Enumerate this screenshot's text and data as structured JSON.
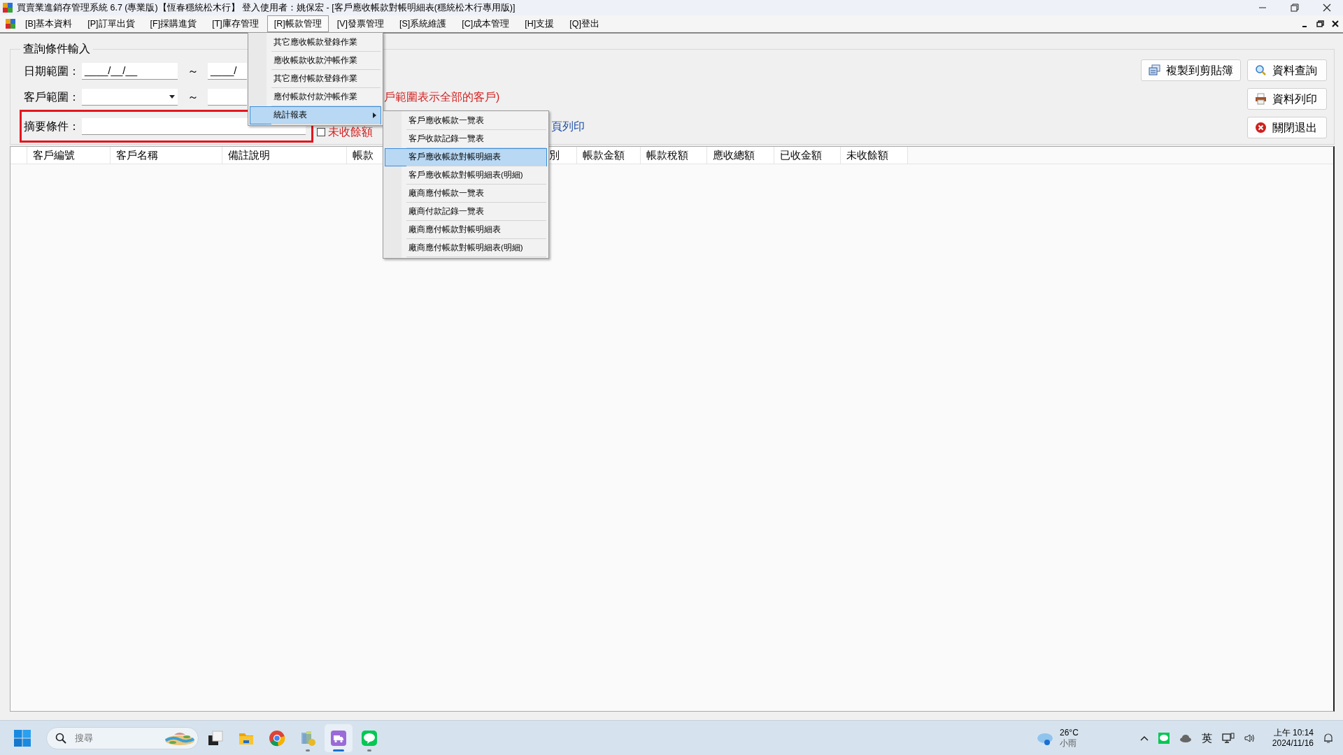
{
  "window": {
    "title": "買賣業進銷存管理系統 6.7 (專業版)【恆春穩統松木行】 登入使用者：姚保宏 - [客戶應收帳款對帳明細表(穩統松木行專用版)]"
  },
  "menu_bar": {
    "items": [
      {
        "label": "[B]基本資料",
        "selected": false
      },
      {
        "label": "[P]訂單出貨",
        "selected": false
      },
      {
        "label": "[F]採購進貨",
        "selected": false
      },
      {
        "label": "[T]庫存管理",
        "selected": false
      },
      {
        "label": "[R]帳款管理",
        "selected": true
      },
      {
        "label": "[V]發票管理",
        "selected": false
      },
      {
        "label": "[S]系統維護",
        "selected": false
      },
      {
        "label": "[C]成本管理",
        "selected": false
      },
      {
        "label": "[H]支援",
        "selected": false
      },
      {
        "label": "[Q]登出",
        "selected": false
      }
    ]
  },
  "dropdown": {
    "items": [
      {
        "label": "其它應收帳款登錄作業",
        "selected": false,
        "has_submenu": false
      },
      {
        "label": "應收帳款收款沖帳作業",
        "selected": false,
        "has_submenu": false
      },
      {
        "label": "其它應付帳款登錄作業",
        "selected": false,
        "has_submenu": false
      },
      {
        "label": "應付帳款付款沖帳作業",
        "selected": false,
        "has_submenu": false
      },
      {
        "label": "統計報表",
        "selected": true,
        "has_submenu": true
      }
    ]
  },
  "submenu": {
    "items": [
      {
        "label": "客戶應收帳款一覽表",
        "selected": false
      },
      {
        "label": "客戶收款記錄一覽表",
        "selected": false
      },
      {
        "label": "客戶應收帳款對帳明細表",
        "selected": true
      },
      {
        "label": "客戶應收帳款對帳明細表(明細)",
        "selected": false
      },
      {
        "label": "廠商應付帳款一覽表",
        "selected": false
      },
      {
        "label": "廠商付款記錄一覽表",
        "selected": false
      },
      {
        "label": "廠商應付帳款對帳明細表",
        "selected": false
      },
      {
        "label": "廠商應付帳款對帳明細表(明細)",
        "selected": false
      }
    ]
  },
  "filter_group": {
    "title": "查詢條件輸入",
    "date_range": {
      "label": "日期範圍：",
      "from": "____/__/__",
      "separator": "～",
      "to": "____/"
    },
    "customer_range": {
      "label": "客戶範圍：",
      "separator": "～",
      "hint": "戶範圍表示全部的客戶)"
    },
    "summary": {
      "label": "摘要條件：",
      "highlighted": true
    },
    "unpaid_only": {
      "label": "未收餘額",
      "checked": false
    },
    "page_break": {
      "label": "頁列印"
    }
  },
  "buttons": [
    {
      "label": "複製到剪貼簿",
      "kind": "copy"
    },
    {
      "label": "資料查詢",
      "kind": "search"
    },
    {
      "label": "資料列印",
      "kind": "print"
    },
    {
      "label": "關閉退出",
      "kind": "close"
    }
  ],
  "table": {
    "columns": [
      "客戶編號",
      "客戶名稱",
      "備註說明",
      "帳款",
      "別",
      "帳款金額",
      "帳款稅額",
      "應收總額",
      "已收金額",
      "未收餘額"
    ]
  },
  "taskbar": {
    "search": {
      "placeholder": "搜尋"
    },
    "apps": [
      {
        "kind": "task-view",
        "running": false,
        "active": false
      },
      {
        "kind": "folder",
        "running": false,
        "active": false
      },
      {
        "kind": "browser",
        "running": false,
        "active": false
      },
      {
        "kind": "books",
        "running": true,
        "active": false
      },
      {
        "kind": "truck",
        "running": true,
        "active": true
      },
      {
        "kind": "chat",
        "running": true,
        "active": false
      }
    ],
    "weather": {
      "temp": "26°C",
      "condition": "小雨"
    },
    "ime": "英",
    "time": "上午 10:14",
    "date": "2024/11/16"
  }
}
